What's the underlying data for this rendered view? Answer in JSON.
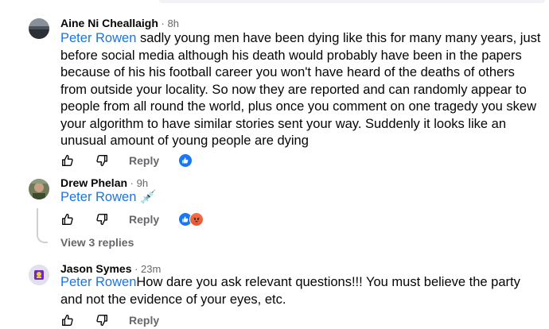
{
  "comments": [
    {
      "author": "Aine Ni Cheallaigh",
      "time": " · 8h",
      "mention": "Peter Rowen",
      "text": " sadly young men have been dying like this for many many years, just before social media although his death would probably have been in the papers because of his his football career you won't have heard of the deaths of others from outside your locality. So now they are reported and can randomly appear to people from all round the world, plus once you comment on one tragedy you skew your algorithm to have similar stories sent your way. Suddenly it looks like an unusual amount of young people are dying",
      "reply_label": "Reply",
      "reactions": [
        "like-reaction"
      ]
    },
    {
      "author": "Drew Phelan",
      "time": " · 9h",
      "mention": "Peter Rowen",
      "text": " 💉",
      "reply_label": "Reply",
      "reactions": [
        "like-reaction",
        "angry-reaction"
      ],
      "view_replies": "View 3 replies"
    },
    {
      "author": "Jason Symes",
      "time": " · 23m",
      "mention": "Peter Rowen",
      "text": "How dare you ask relevant questions!!! You must believe the party and not the evidence of your eyes, etc.",
      "reply_label": "Reply"
    }
  ],
  "icons": {
    "like": "thumbs-up-icon",
    "dislike": "thumbs-down-icon"
  },
  "colors": {
    "mention": "#1b74e4",
    "secondary_text": "#65676b",
    "like_blue": "#1877f2",
    "angry_orange": "#f26b43"
  }
}
